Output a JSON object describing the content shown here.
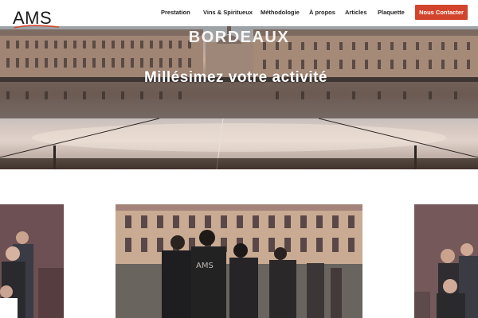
{
  "brand": {
    "logo_text": "AMS"
  },
  "nav": {
    "items": [
      {
        "label": "Prestation"
      },
      {
        "label": "Vins & Spiritueux"
      },
      {
        "label": "Méthodologie"
      },
      {
        "label": "À propos"
      },
      {
        "label": "Articles"
      },
      {
        "label": "Plaquette"
      }
    ],
    "cta_label": "Nous Contacter"
  },
  "hero": {
    "title": "BORDEAUX",
    "subtitle": "Millésimez votre activité"
  },
  "colors": {
    "accent": "#d2452c",
    "text": "#222222"
  }
}
